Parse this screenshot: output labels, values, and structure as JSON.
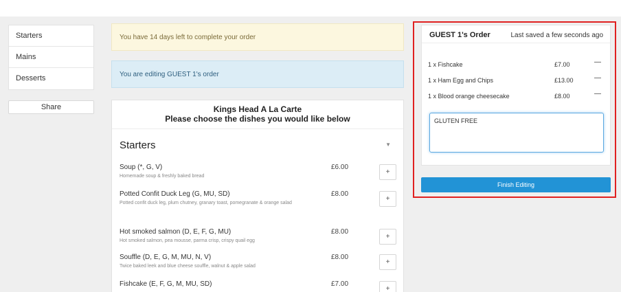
{
  "nav": {
    "items": [
      "Starters",
      "Mains",
      "Desserts"
    ],
    "share_label": "Share"
  },
  "alerts": {
    "days_left": "You have 14 days left to complete your order",
    "editing": "You are editing GUEST 1's order"
  },
  "menu": {
    "title": "Kings Head A La Carte",
    "subtitle": "Please choose the dishes you would like below",
    "section": "Starters",
    "caret": "▼",
    "add_label": "+",
    "dishes": [
      {
        "name": "Soup (*, G, V)",
        "desc": "Homemade soup & freshly baked bread",
        "price": "£6.00"
      },
      {
        "name": "Potted Confit Duck Leg (G, MU, SD)",
        "desc": "Potted confit duck leg, plum chutney, granary toast, pomegranate & orange salad",
        "price": "£8.00"
      },
      {
        "name": "Hot smoked salmon (D, E, F, G, MU)",
        "desc": "Hot smoked salmon, pea mousse, parma crisp, crispy quail egg",
        "price": "£8.00"
      },
      {
        "name": "Souffle (D, E, G, M, MU, N, V)",
        "desc": "Twice baked leek and blue cheese souffle, walnut & apple salad",
        "price": "£8.00"
      },
      {
        "name": "Fishcake (E, F, G, M, MU, SD)",
        "desc": "",
        "price": "£7.00"
      }
    ]
  },
  "order": {
    "title": "GUEST 1's Order",
    "saved": "Last saved a few seconds ago",
    "remove_label": "—",
    "items": [
      {
        "label": "1 x Fishcake",
        "price": "£7.00"
      },
      {
        "label": "1 x Ham Egg and Chips",
        "price": "£13.00"
      },
      {
        "label": "1 x Blood orange cheesecake",
        "price": "£8.00"
      }
    ],
    "notes_value": "GLUTEN FREE",
    "finish_label": "Finish Editing"
  },
  "colors": {
    "accent": "#2293d6",
    "highlight_outline": "#e02020"
  }
}
